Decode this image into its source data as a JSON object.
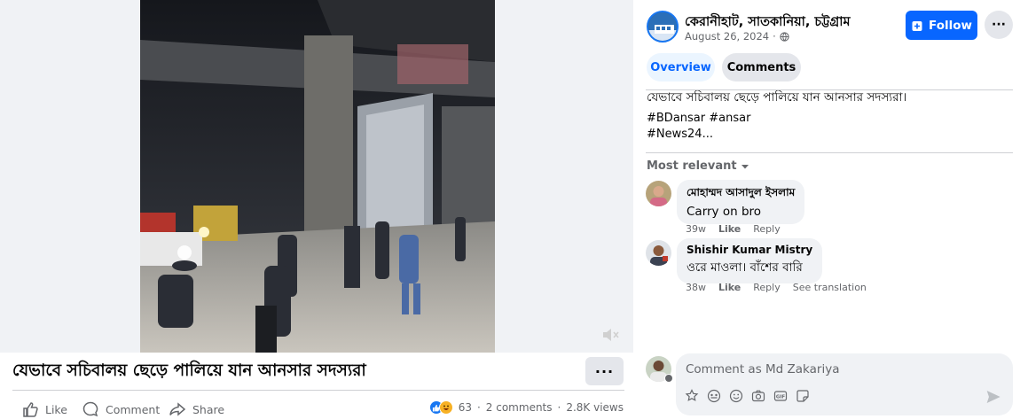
{
  "video": {
    "title": "যেভাবে সচিবালয় ছেড়ে পালিয়ে যান আনসার সদস্যরা",
    "more_label": "···",
    "mute_icon": "speaker-muted-icon"
  },
  "actions": {
    "like": "Like",
    "comment": "Comment",
    "share": "Share"
  },
  "stats": {
    "reaction_count": "63",
    "separator": "·",
    "comments": "2 comments",
    "views": "2.8K views"
  },
  "page": {
    "name": "কেরানীহাট, সাতকানিয়া, চট্টগ্রাম",
    "date": "August 26, 2024",
    "date_separator": "·",
    "follow_label": "Follow",
    "more_label": "···"
  },
  "tabs": {
    "overview": "Overview",
    "comments": "Comments"
  },
  "post": {
    "caption": "যেভাবে সচিবালয় ছেড়ে পালিয়ে যান আনসার সদস্যরা।",
    "hashtags_line1": "#BDansar #ansar",
    "hashtags_line2": "#News24..."
  },
  "comments_section": {
    "sort_label": "Most relevant",
    "items": [
      {
        "author": "মোহাম্মদ আসাদুল ইসলাম",
        "text": "Carry on bro",
        "time": "39w",
        "like": "Like",
        "reply": "Reply"
      },
      {
        "author": "Shishir Kumar Mistry",
        "text": "ওরে মাওলা। বাঁশের বারি",
        "time": "38w",
        "like": "Like",
        "reply": "Reply",
        "translate": "See translation"
      }
    ]
  },
  "composer": {
    "placeholder": "Comment as Md Zakariya"
  },
  "colors": {
    "accent": "#0866ff",
    "secondary_text": "#65676b",
    "bubble": "#f0f2f5"
  }
}
